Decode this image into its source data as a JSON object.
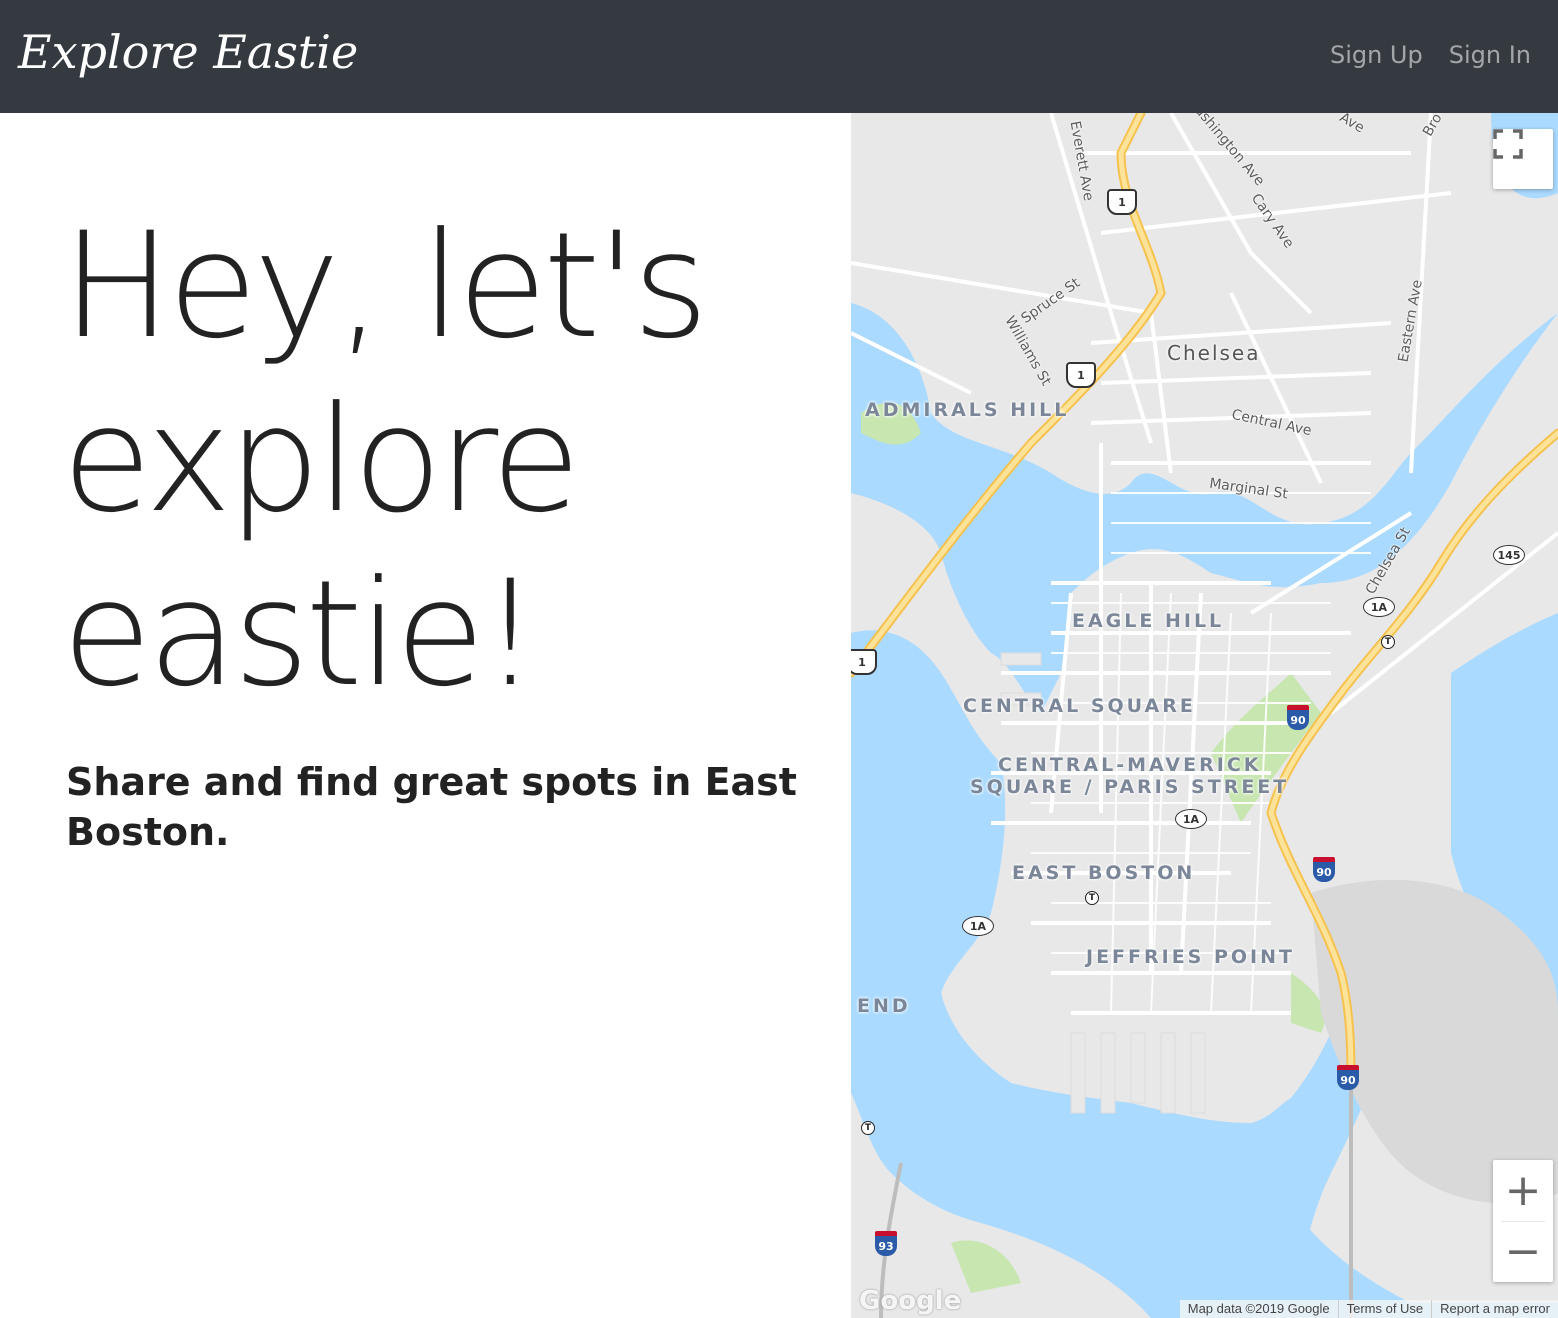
{
  "nav": {
    "brand": "Explore Eastie",
    "links": [
      "Sign Up",
      "Sign In"
    ]
  },
  "hero": {
    "headline_lines": [
      "Hey, let's",
      "explore",
      "eastie!"
    ],
    "subhead": "Share and find great spots in East Boston."
  },
  "map": {
    "neighborhoods": [
      "ADMIRALS HILL",
      "EAGLE HILL",
      "CENTRAL SQUARE",
      "CENTRAL-MAVERICK",
      "SQUARE / PARIS STREET",
      "EAST BOSTON",
      "JEFFRIES POINT",
      "END"
    ],
    "city": "Chelsea",
    "streets": [
      "Everett Ave",
      "Washington Ave",
      "Cary Ave",
      "Spruce St",
      "Williams St",
      "Central Ave",
      "Marginal St",
      "Eastern Ave",
      "Chelsea St",
      "Ave",
      "Bro"
    ],
    "shields": [
      "1",
      "1",
      "1",
      "145",
      "1A",
      "90",
      "1A",
      "90",
      "1A",
      "90",
      "93"
    ],
    "controls": {
      "fullscreen_icon": "fullscreen-icon",
      "zoom_in": "+",
      "zoom_out": "−"
    },
    "attribution": [
      "Map data ©2019 Google",
      "Terms of Use",
      "Report a map error"
    ],
    "logo": "Google",
    "colors": {
      "water": "#aadaff",
      "land": "#e8e8e8",
      "highway": "#fcd66e",
      "park": "#c8e6b0",
      "road": "#ffffff"
    }
  },
  "theme": {
    "navbar_bg": "#343a40",
    "text": "#222222",
    "nav_link": "rgba(255,255,255,0.55)"
  }
}
